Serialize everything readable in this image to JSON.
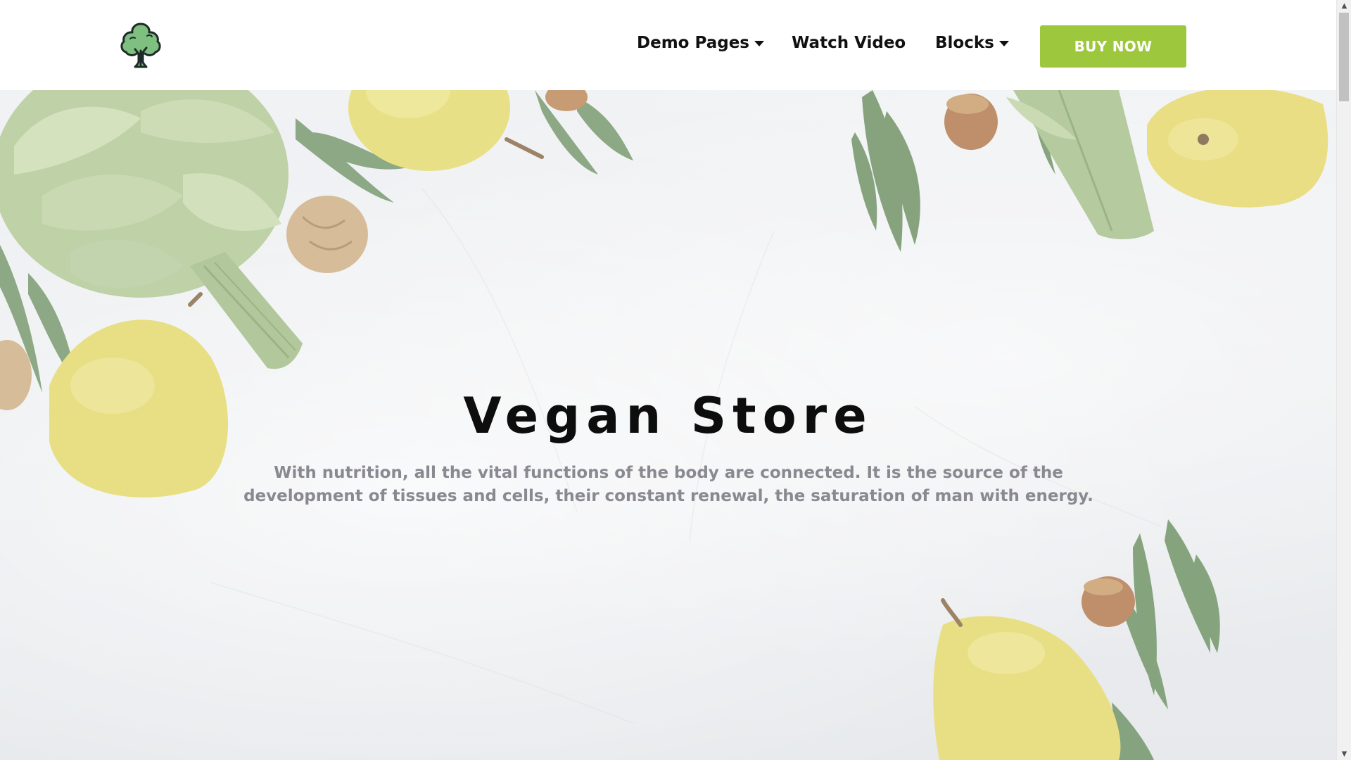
{
  "header": {
    "logo_icon": "broccoli-tree-icon",
    "nav": {
      "demo_pages": "Demo Pages",
      "watch_video": "Watch Video",
      "blocks": "Blocks"
    },
    "buy_now": "BUY NOW"
  },
  "hero": {
    "title": "Vegan Store",
    "description": "With nutrition, all the vital functions of the body are connected. It is the source of the development of tissues and cells, their constant renewal, the saturation of man with energy.",
    "background_theme": "pears-artichoke-nuts-on-marble"
  },
  "colors": {
    "accent": "#9dc73c",
    "title": "#0d0d0d",
    "description": "#8a8991",
    "logo_green": "#7fbf7f"
  },
  "scrollbar": {
    "up_icon": "chevron-up-icon",
    "down_icon": "chevron-down-icon"
  }
}
